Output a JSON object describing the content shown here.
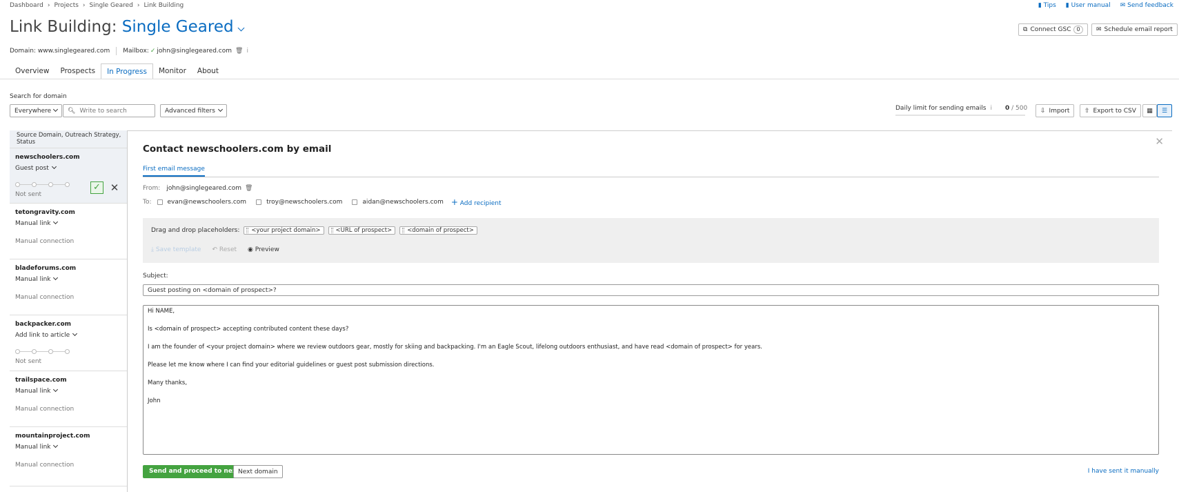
{
  "breadcrumb": [
    "Dashboard",
    "Projects",
    "Single Geared",
    "Link Building"
  ],
  "header_links": {
    "tips": "Tips",
    "manual": "User manual",
    "feedback": "Send feedback"
  },
  "title": {
    "prefix": "Link Building:",
    "project": "Single Geared"
  },
  "top_buttons": {
    "connect_gsc": "Connect GSC",
    "gsc_count": "0",
    "schedule": "Schedule email report"
  },
  "meta": {
    "domain_label": "Domain:",
    "domain": "www.singlegeared.com",
    "mailbox_label": "Mailbox:",
    "mailbox": "john@singlegeared.com"
  },
  "tabs": [
    "Overview",
    "Prospects",
    "In Progress",
    "Monitor",
    "About"
  ],
  "search": {
    "label": "Search for domain",
    "scope": "Everywhere",
    "placeholder": "Write to search",
    "advanced": "Advanced filters"
  },
  "limit": {
    "label": "Daily limit for sending emails",
    "used": "0",
    "total": "/ 500",
    "used_fraction": 0
  },
  "actions": {
    "import": "Import",
    "export": "Export to CSV"
  },
  "sidebar": {
    "header": "Source Domain, Outreach Strategy, Status",
    "items": [
      {
        "domain": "newschoolers.com",
        "strategy": "Guest post",
        "status": "Not sent"
      },
      {
        "domain": "tetongravity.com",
        "strategy": "Manual link",
        "status": "Manual connection"
      },
      {
        "domain": "bladeforums.com",
        "strategy": "Manual link",
        "status": "Manual connection"
      },
      {
        "domain": "backpacker.com",
        "strategy": "Add link to article",
        "status": "Not sent"
      },
      {
        "domain": "trailspace.com",
        "strategy": "Manual link",
        "status": "Manual connection"
      },
      {
        "domain": "mountainproject.com",
        "strategy": "Manual link",
        "status": "Manual connection"
      }
    ]
  },
  "contact": {
    "title": "Contact newschoolers.com by email",
    "tab": "First email message",
    "from_label": "From:",
    "from": "john@singlegeared.com",
    "to_label": "To:",
    "recipients": [
      "evan@newschoolers.com",
      "troy@newschoolers.com",
      "aidan@newschoolers.com"
    ],
    "add_recipient": "Add recipient",
    "placeholders_label": "Drag and drop placeholders:",
    "placeholders": [
      "<your project domain>",
      "<URL of prospect>",
      "<domain of prospect>"
    ],
    "save_template": "Save template",
    "reset": "Reset",
    "preview": "Preview",
    "subject_label": "Subject:",
    "subject": "Guest posting on <domain of prospect>?",
    "body": [
      "Hi NAME,",
      "Is <domain of prospect> accepting contributed content these days?",
      "I am the founder of <your project domain> where we review outdoors gear, mostly for skiing and backpacking. I'm an Eagle Scout, lifelong outdoors enthusiast, and have read <domain of prospect> for years.",
      "Please let me know where I can find your editorial guidelines  or guest post submission directions.",
      "Many thanks,",
      "John"
    ],
    "send": "Send and proceed to next",
    "next": "Next domain",
    "sent_manually": "I have sent it manually"
  },
  "colors": {
    "accent": "#0a6cc1",
    "send": "#44a340",
    "panel": "#efefef"
  }
}
